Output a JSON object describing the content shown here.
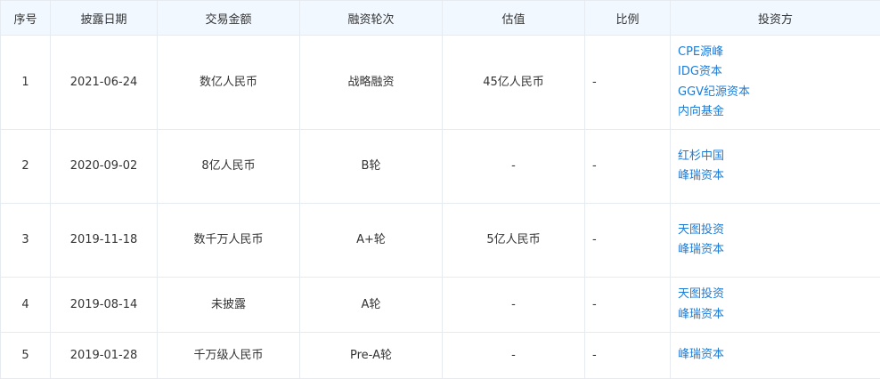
{
  "table": {
    "headers": [
      "序号",
      "披露日期",
      "交易金额",
      "融资轮次",
      "估值",
      "比例",
      "投资方"
    ],
    "rows": [
      {
        "index": "1",
        "date": "2021-06-24",
        "amount": "数亿人民币",
        "round": "战略融资",
        "valuation": "45亿人民币",
        "ratio": "-",
        "investors": [
          "CPE源峰",
          "IDG资本",
          "GGV纪源资本",
          "内向基金"
        ]
      },
      {
        "index": "2",
        "date": "2020-09-02",
        "amount": "8亿人民币",
        "round": "B轮",
        "valuation": "-",
        "ratio": "-",
        "investors": [
          "红杉中国",
          "峰瑞资本"
        ]
      },
      {
        "index": "3",
        "date": "2019-11-18",
        "amount": "数千万人民币",
        "round": "A+轮",
        "valuation": "5亿人民币",
        "ratio": "-",
        "investors": [
          "天图投资",
          "峰瑞资本"
        ]
      },
      {
        "index": "4",
        "date": "2019-08-14",
        "amount": "未披露",
        "round": "A轮",
        "valuation": "-",
        "ratio": "-",
        "investors": [
          "天图投资",
          "峰瑞资本"
        ]
      },
      {
        "index": "5",
        "date": "2019-01-28",
        "amount": "千万级人民币",
        "round": "Pre-A轮",
        "valuation": "-",
        "ratio": "-",
        "investors": [
          "峰瑞资本"
        ]
      }
    ]
  },
  "colors": {
    "header_bg": "#f1f8ff",
    "border": "#e6ebf2",
    "text": "#333333",
    "link": "#1a7cd9"
  }
}
